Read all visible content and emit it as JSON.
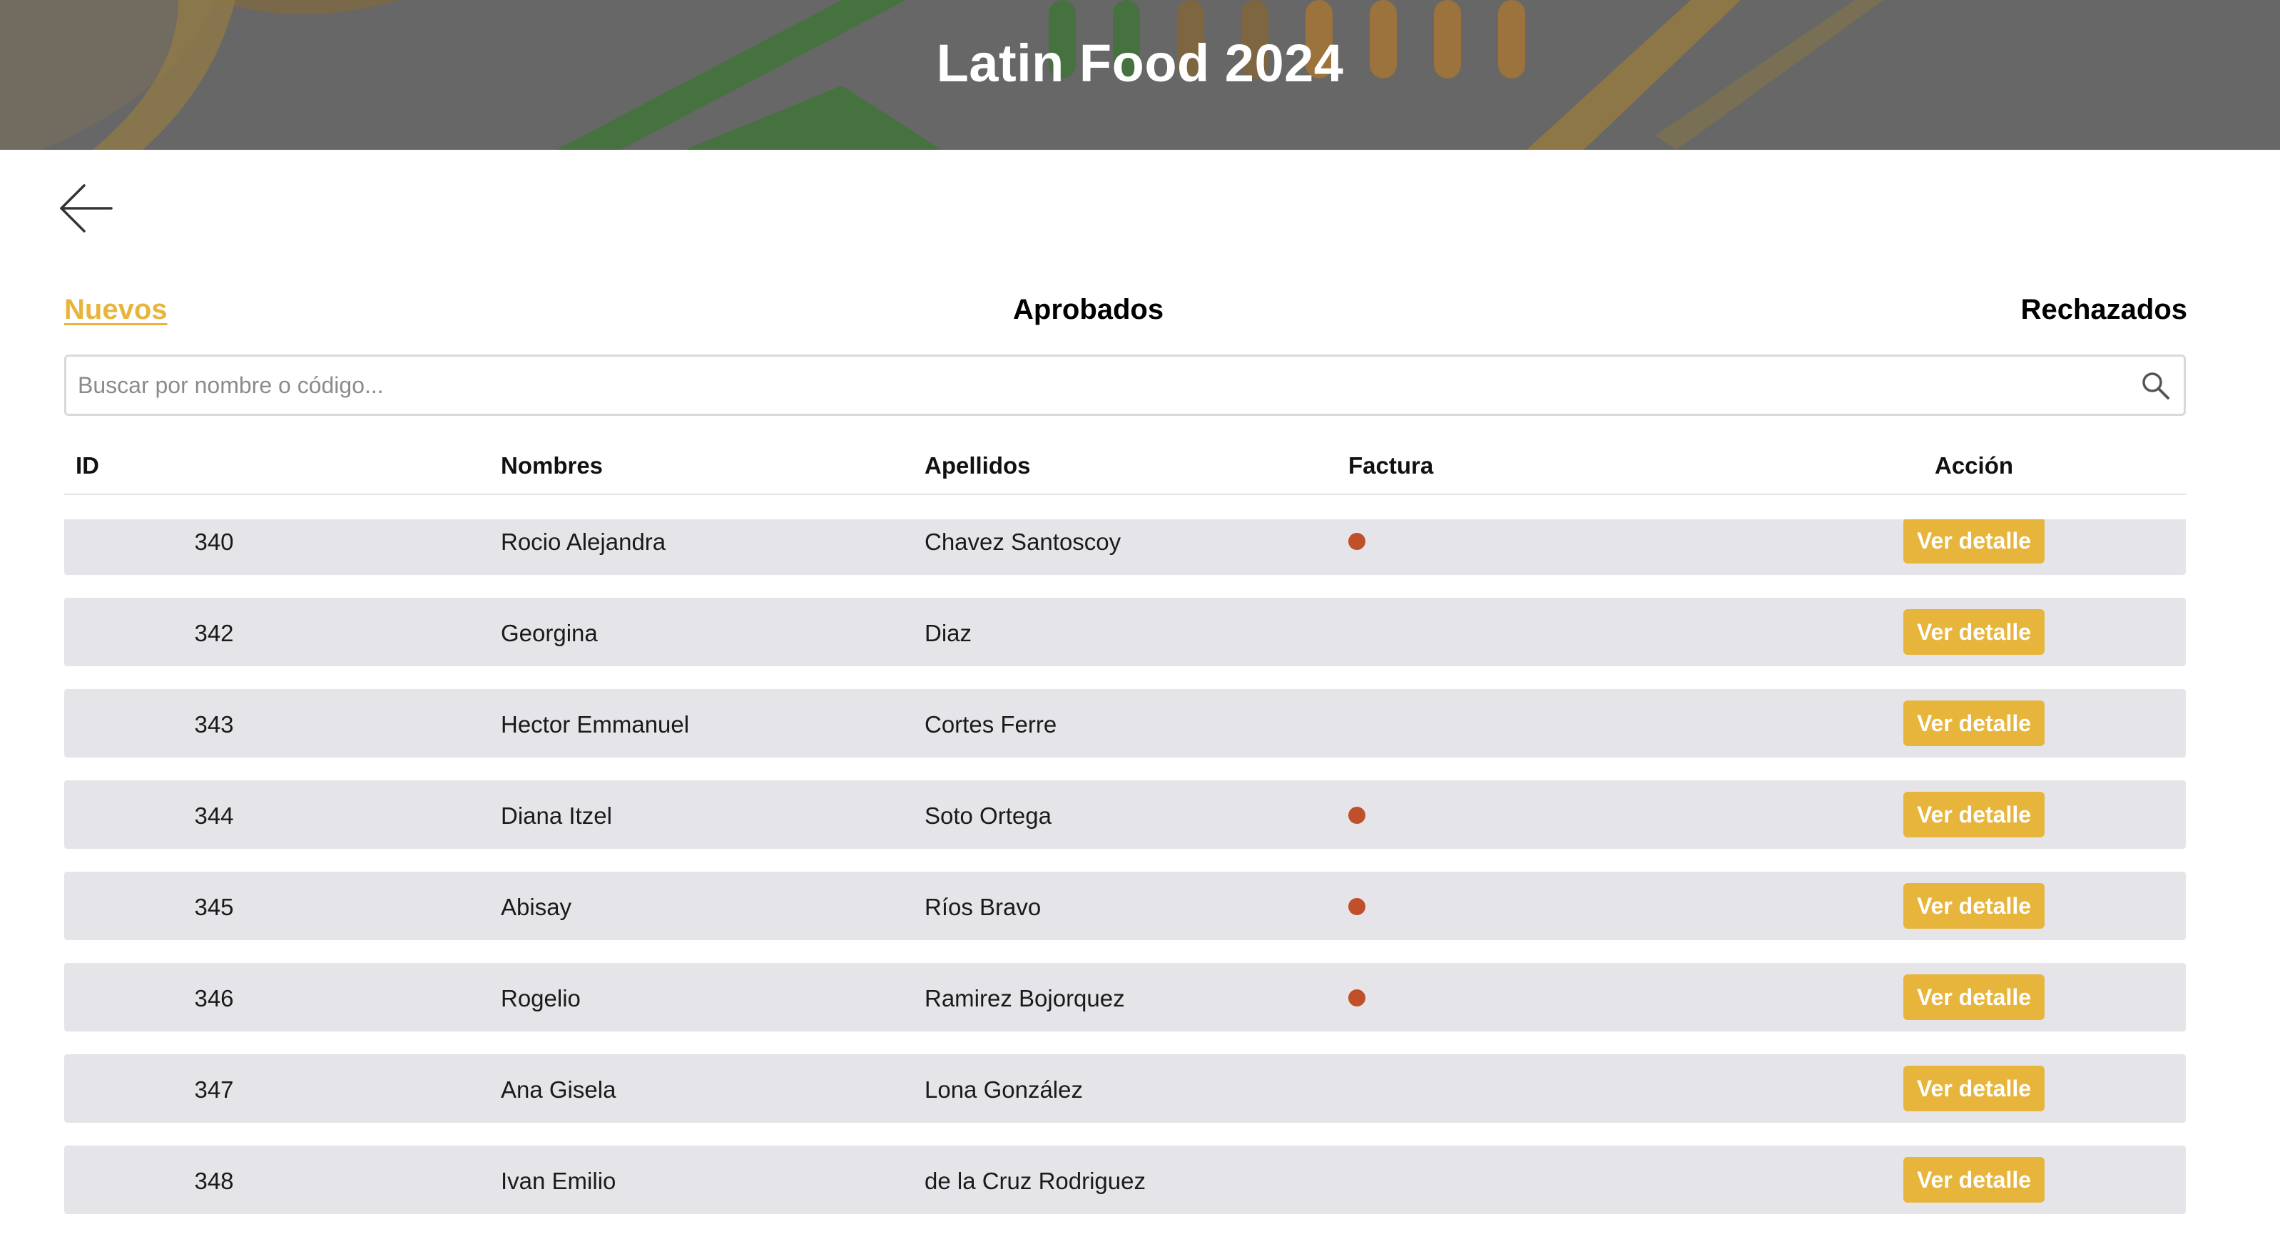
{
  "header": {
    "title": "Latin Food 2024",
    "accent_green": "#3f8a3a",
    "accent_orange": "#e08a2c"
  },
  "nav": {
    "back_icon": "arrow-left-icon"
  },
  "tabs": [
    {
      "label": "Nuevos",
      "active": true
    },
    {
      "label": "Aprobados",
      "active": false
    },
    {
      "label": "Rechazados",
      "active": false
    }
  ],
  "search": {
    "placeholder": "Buscar por nombre o código...",
    "value": "",
    "icon": "search-icon"
  },
  "table": {
    "columns": [
      "ID",
      "Nombres",
      "Apellidos",
      "Factura",
      "Acción"
    ],
    "action_label": "Ver detalle",
    "factura_marker_color": "#c0502a",
    "rows": [
      {
        "id": "340",
        "nombres": "Rocio Alejandra",
        "apellidos": "Chavez Santoscoy",
        "factura": true
      },
      {
        "id": "342",
        "nombres": "Georgina",
        "apellidos": "Diaz",
        "factura": false
      },
      {
        "id": "343",
        "nombres": "Hector Emmanuel",
        "apellidos": "Cortes Ferre",
        "factura": false
      },
      {
        "id": "344",
        "nombres": "Diana Itzel",
        "apellidos": "Soto Ortega",
        "factura": true
      },
      {
        "id": "345",
        "nombres": "Abisay",
        "apellidos": "Ríos Bravo",
        "factura": true
      },
      {
        "id": "346",
        "nombres": "Rogelio",
        "apellidos": "Ramirez Bojorquez",
        "factura": true
      },
      {
        "id": "347",
        "nombres": "Ana Gisela",
        "apellidos": "Lona González",
        "factura": false
      },
      {
        "id": "348",
        "nombres": "Ivan Emilio",
        "apellidos": "de la Cruz Rodriguez",
        "factura": false
      }
    ]
  }
}
